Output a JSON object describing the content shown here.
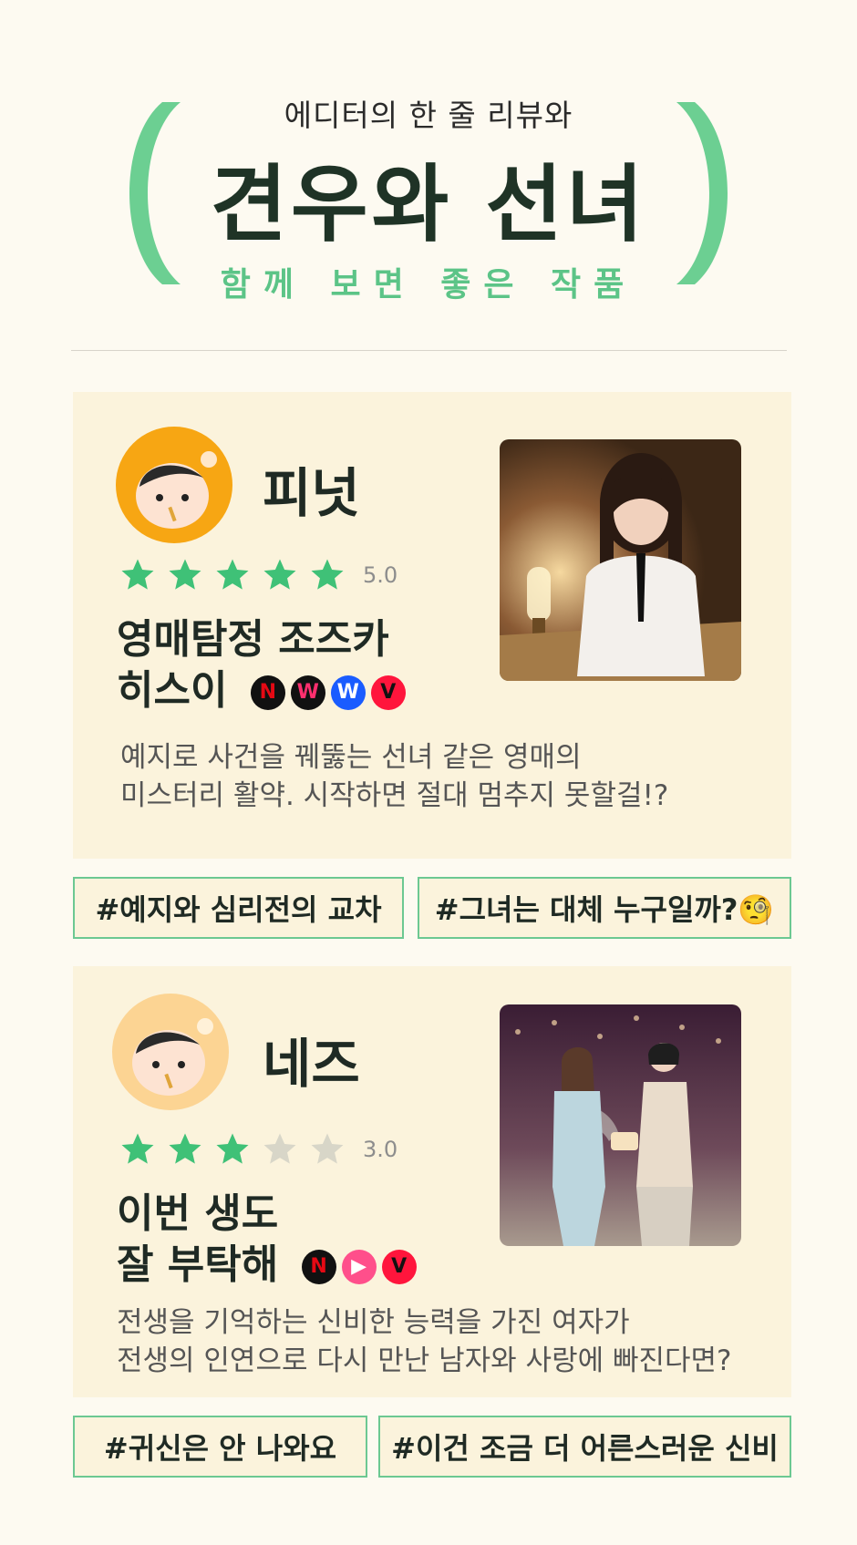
{
  "header": {
    "subtitle": "에디터의 한 줄 리뷰와",
    "title": "견우와 선녀",
    "tagline": "함께 보면 좋은 작품",
    "accent_color": "#6ccf92"
  },
  "reviews": [
    {
      "reviewer": "피넛",
      "avatar_icon": "peanut-character-icon",
      "rating": 5,
      "rating_label": "5.0",
      "title_line1": "영매탐정 조즈카",
      "title_line2": "히스이",
      "platforms": [
        "netflix-icon",
        "watcha-icon",
        "wavve-icon",
        "tving-icon"
      ],
      "description_line1": "예지로 사건을 꿰뚫는 선녀 같은 영매의",
      "description_line2": "미스터리 활약. 시작하면 절대 멈추지 못할걸!?",
      "tags": [
        "#예지와 심리전의 교차",
        "#그녀는 대체 누구일까?🧐"
      ]
    },
    {
      "reviewer": "네즈",
      "avatar_icon": "nez-character-icon",
      "rating": 3,
      "rating_label": "3.0",
      "title_line1": "이번 생도",
      "title_line2": "잘 부탁해",
      "platforms": [
        "netflix-icon",
        "tvn-icon",
        "tving-icon"
      ],
      "description_line1": "전생을 기억하는 신비한 능력을 가진 여자가",
      "description_line2": "전생의 인연으로 다시 만난 남자와 사랑에 빠진다면?",
      "tags": [
        "#귀신은 안 나와요",
        "#이건 조금 더 어른스러운 신비"
      ]
    }
  ]
}
